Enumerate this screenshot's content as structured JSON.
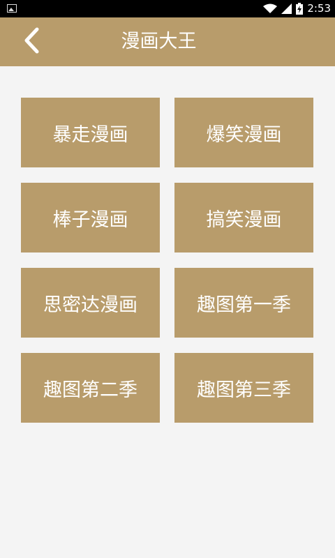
{
  "status_bar": {
    "time": "2:53"
  },
  "header": {
    "title": "漫画大王",
    "back_icon": "chevron-left-icon"
  },
  "categories": [
    {
      "label": "暴走漫画"
    },
    {
      "label": "爆笑漫画"
    },
    {
      "label": "棒子漫画"
    },
    {
      "label": "搞笑漫画"
    },
    {
      "label": "思密达漫画"
    },
    {
      "label": "趣图第一季"
    },
    {
      "label": "趣图第二季"
    },
    {
      "label": "趣图第三季"
    }
  ],
  "colors": {
    "accent": "#b89c6b",
    "background": "#f4f4f4",
    "status_bar": "#000000",
    "text_on_accent": "#ffffff"
  }
}
